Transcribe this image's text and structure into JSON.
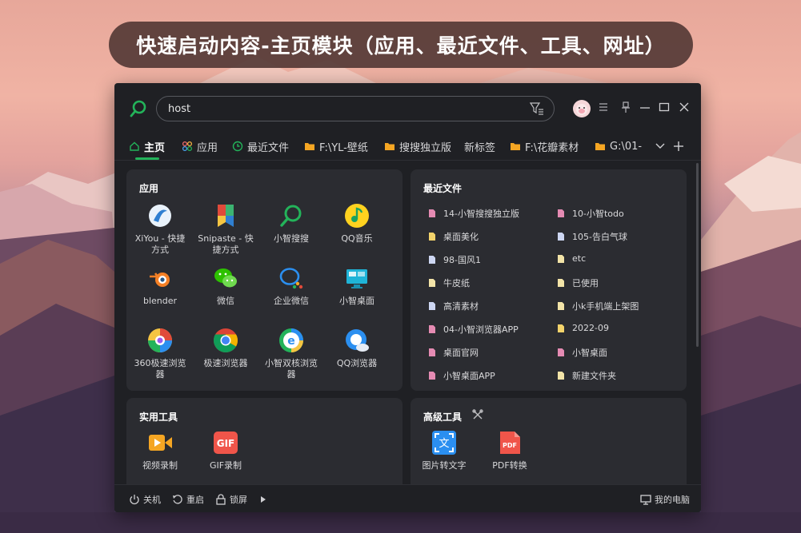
{
  "banner": {
    "title": "快速启动内容-主页模块（应用、最近文件、工具、网址）"
  },
  "search": {
    "value": "host"
  },
  "tabs": [
    {
      "label": "主页",
      "icon": "home-icon"
    },
    {
      "label": "应用",
      "icon": "apps-icon"
    },
    {
      "label": "最近文件",
      "icon": "clock-icon"
    },
    {
      "label": "F:\\YL-壁纸",
      "icon": "folder-icon"
    },
    {
      "label": "搜搜独立版",
      "icon": "folder-icon"
    },
    {
      "label": "新标签",
      "icon": ""
    },
    {
      "label": "F:\\花瓣素材",
      "icon": "folder-icon"
    },
    {
      "label": "G:\\01-:",
      "icon": "folder-icon"
    }
  ],
  "apps_panel": {
    "title": "应用",
    "apps": [
      {
        "label": "XiYou - 快捷方式",
        "icon": "xiyou-icon"
      },
      {
        "label": "Snipaste - 快捷方式",
        "icon": "snipaste-icon"
      },
      {
        "label": "小智搜搜",
        "icon": "search-icon"
      },
      {
        "label": "QQ音乐",
        "icon": "qqmusic-icon"
      },
      {
        "label": "blender",
        "icon": "blender-icon"
      },
      {
        "label": "微信",
        "icon": "wechat-icon"
      },
      {
        "label": "企业微信",
        "icon": "wecom-icon"
      },
      {
        "label": "小智桌面",
        "icon": "desktop-icon"
      },
      {
        "label": "360极速浏览器",
        "icon": "browser-360-icon"
      },
      {
        "label": "极速浏览器",
        "icon": "chrome-icon"
      },
      {
        "label": "小智双核浏览器",
        "icon": "browser-e-icon"
      },
      {
        "label": "QQ浏览器",
        "icon": "qqbrowser-icon"
      }
    ]
  },
  "recent_panel": {
    "title": "最近文件",
    "files": [
      {
        "label": "14-小智搜搜独立版",
        "color": "#e58bb3"
      },
      {
        "label": "10-小智todo",
        "color": "#e58bb3"
      },
      {
        "label": "桌面美化",
        "color": "#f3d36b"
      },
      {
        "label": "105-告白气球",
        "color": "#cdd6f2"
      },
      {
        "label": "98-国风1",
        "color": "#cdd6f2"
      },
      {
        "label": "etc",
        "color": "#f3e4a8"
      },
      {
        "label": "牛皮纸",
        "color": "#f3e4a8"
      },
      {
        "label": "已使用",
        "color": "#f3e4a8"
      },
      {
        "label": "高清素材",
        "color": "#cdd6f2"
      },
      {
        "label": "小k手机端上架图",
        "color": "#f3e4a8"
      },
      {
        "label": "04-小智浏览器APP",
        "color": "#e58bb3"
      },
      {
        "label": "2022-09",
        "color": "#f3d36b"
      },
      {
        "label": "桌面官网",
        "color": "#e58bb3"
      },
      {
        "label": "小智桌面",
        "color": "#e58bb3"
      },
      {
        "label": "小智桌面APP",
        "color": "#e58bb3"
      },
      {
        "label": "新建文件夹",
        "color": "#f3e4a8"
      }
    ]
  },
  "tools_panel": {
    "title": "实用工具",
    "tools": [
      {
        "label": "视频录制",
        "icon": "video-record-icon"
      },
      {
        "label": "GIF录制",
        "icon": "gif-icon",
        "badge": "GIF"
      }
    ]
  },
  "advanced_panel": {
    "title": "高级工具",
    "tools": [
      {
        "label": "图片转文字",
        "icon": "ocr-icon",
        "badge": "文"
      },
      {
        "label": "PDF转换",
        "icon": "pdf-icon",
        "badge": "PDF"
      }
    ]
  },
  "statusbar": {
    "shutdown": "关机",
    "restart": "重启",
    "lock": "锁屏",
    "computer": "我的电脑"
  },
  "colors": {
    "accent": "#23b35a",
    "window_bg": "#1f2024",
    "panel_bg": "#2b2c31",
    "banner_bg": "#553a36"
  }
}
